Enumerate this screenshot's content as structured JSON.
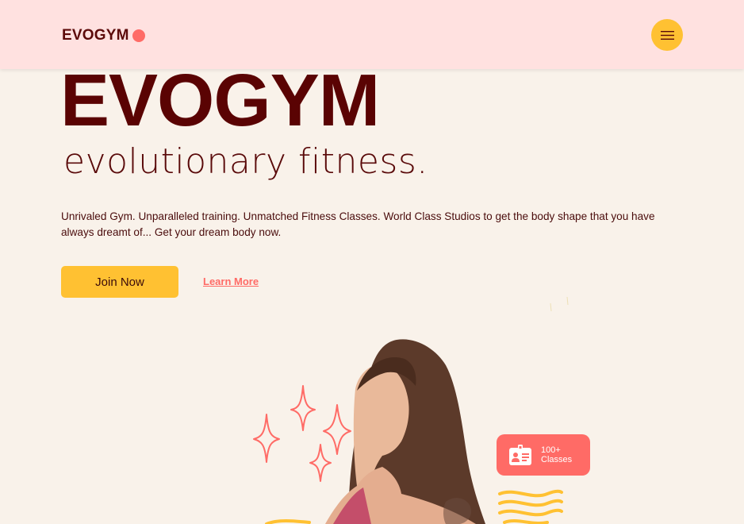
{
  "header": {
    "logo_text": "EVOGYM",
    "menu_icon": "hamburger-menu-icon"
  },
  "hero": {
    "title": "EVOGYM",
    "subtitle": "evolutionary fitness.",
    "description": "Unrivaled Gym. Unparalleled training. Unmatched Fitness Classes. World Class Studios to get the body shape that you have always dreamt of... Get your dream body now.",
    "join_label": "Join Now",
    "learn_more_label": "Learn More"
  },
  "badge": {
    "icon": "id-card-icon",
    "line1": "100+",
    "line2": "Classes"
  },
  "colors": {
    "background": "#f9f2ea",
    "header_bg": "#ffe1e0",
    "primary_dark": "#5a0303",
    "accent_yellow": "#ffc132",
    "accent_coral": "#ff6b66"
  }
}
